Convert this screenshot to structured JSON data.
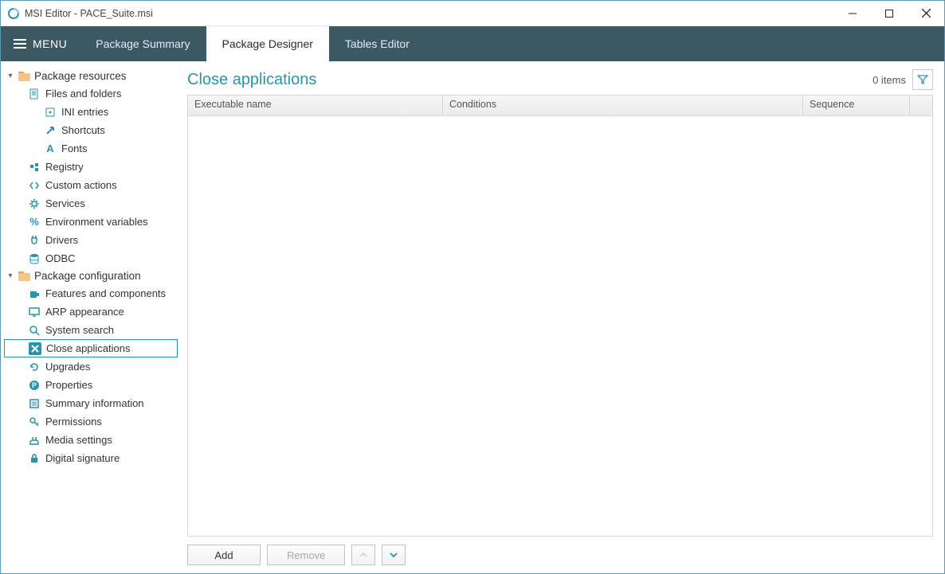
{
  "window": {
    "title": "MSI Editor - PACE_Suite.msi"
  },
  "menu": {
    "label": "MENU"
  },
  "tabs": {
    "summary": "Package Summary",
    "designer": "Package Designer",
    "tables": "Tables Editor"
  },
  "sidebar": {
    "groups": [
      {
        "label": "Package resources",
        "items": [
          {
            "label": "Files and folders",
            "children": [
              {
                "label": "INI entries"
              },
              {
                "label": "Shortcuts"
              },
              {
                "label": "Fonts"
              }
            ]
          },
          {
            "label": "Registry"
          },
          {
            "label": "Custom actions"
          },
          {
            "label": "Services"
          },
          {
            "label": "Environment variables"
          },
          {
            "label": "Drivers"
          },
          {
            "label": "ODBC"
          }
        ]
      },
      {
        "label": "Package configuration",
        "items": [
          {
            "label": "Features and components"
          },
          {
            "label": "ARP appearance"
          },
          {
            "label": "System search"
          },
          {
            "label": "Close applications"
          },
          {
            "label": "Upgrades"
          },
          {
            "label": "Properties"
          },
          {
            "label": "Summary information"
          },
          {
            "label": "Permissions"
          },
          {
            "label": "Media settings"
          },
          {
            "label": "Digital signature"
          }
        ]
      }
    ]
  },
  "page": {
    "title": "Close applications",
    "items_count": "0 items"
  },
  "grid": {
    "columns": {
      "exe": "Executable name",
      "cond": "Conditions",
      "seq": "Sequence"
    }
  },
  "actions": {
    "add": "Add",
    "remove": "Remove"
  }
}
